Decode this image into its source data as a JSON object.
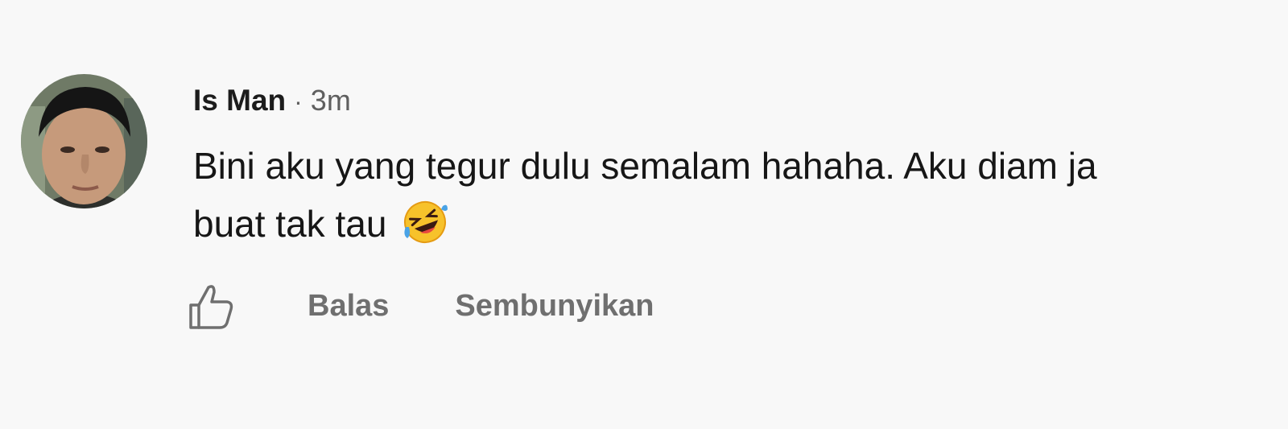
{
  "comment": {
    "author": "Is Man",
    "separator": "·",
    "time": "3m",
    "text_line1": "Bini aku yang tegur dulu semalam hahaha. Aku diam ja",
    "text_line2": "buat tak tau",
    "emoji_icon": "rolling-on-floor-laughing-emoji"
  },
  "actions": {
    "like_icon": "thumbs-up-icon",
    "reply_label": "Balas",
    "hide_label": "Sembunyikan"
  },
  "colors": {
    "background": "#f8f8f8",
    "author": "#1c1c1c",
    "muted": "#6f6f6f"
  }
}
